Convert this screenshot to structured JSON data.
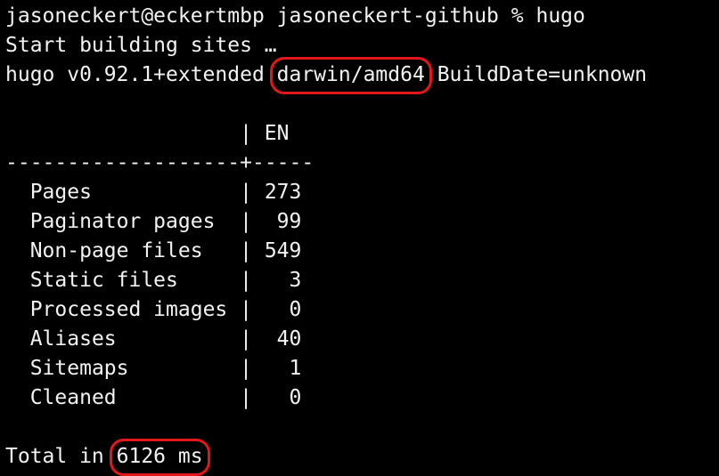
{
  "terminal": {
    "prompt_user": "jasoneckert@eckertmbp",
    "prompt_dir": "jasoneckert-github",
    "prompt_symbol": "%",
    "command": "hugo",
    "start_line": "Start building sites …",
    "version_prefix": "hugo v0.92.1+extended",
    "platform": "darwin/amd64",
    "build_date": "BuildDate=unknown",
    "table_header": {
      "column": "EN"
    },
    "separator_left": "-------------------",
    "separator_cross": "+",
    "separator_right": "-----",
    "rows": [
      {
        "label": "Pages",
        "value": "273"
      },
      {
        "label": "Paginator pages",
        "value": "99"
      },
      {
        "label": "Non-page files",
        "value": "549"
      },
      {
        "label": "Static files",
        "value": "3"
      },
      {
        "label": "Processed images",
        "value": "0"
      },
      {
        "label": "Aliases",
        "value": "40"
      },
      {
        "label": "Sitemaps",
        "value": "1"
      },
      {
        "label": "Cleaned",
        "value": "0"
      }
    ],
    "total_prefix": "Total in",
    "total_time": "6126 ms"
  },
  "colors": {
    "background": "#000000",
    "text": "#f2f2f2",
    "highlight": "#e3161b"
  }
}
